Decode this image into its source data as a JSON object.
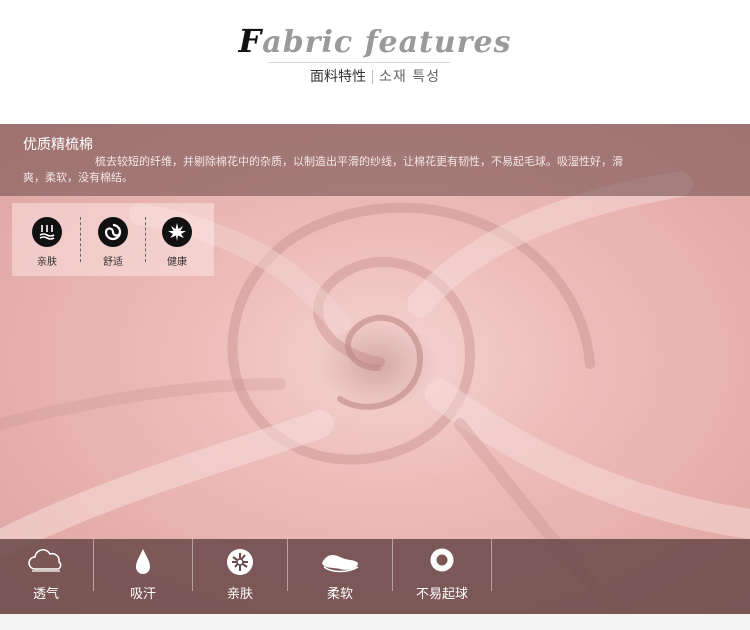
{
  "header": {
    "title_cap": "F",
    "title_rest": "abric features",
    "subtitle_cn": "面料特性",
    "subtitle_kr": "소재 특성"
  },
  "banner": {
    "heading": "优质精梳棉",
    "description": "梳去较短的纤维，并剔除棉花中的杂质，以制造出平滑的纱线，让棉花更有韧性，不易起毛球。吸湿性好，滑爽，柔软，没有棉结。"
  },
  "features": [
    {
      "label": "亲肤",
      "icon": "skin-friendly-icon"
    },
    {
      "label": "舒适",
      "icon": "comfort-swirl-icon"
    },
    {
      "label": "健康",
      "icon": "leaf-icon"
    }
  ],
  "bottom_bar": [
    {
      "label": "透气",
      "icon": "cloud-icon"
    },
    {
      "label": "吸汗",
      "icon": "water-drop-icon"
    },
    {
      "label": "亲肤",
      "icon": "fiber-icon"
    },
    {
      "label": "柔软",
      "icon": "soft-cushion-icon"
    },
    {
      "label": "不易起球",
      "icon": "ring-icon"
    }
  ],
  "colors": {
    "fabric_pink": "#edbcb9",
    "banner_overlay": "#785452",
    "bottom_bar": "#694848"
  }
}
